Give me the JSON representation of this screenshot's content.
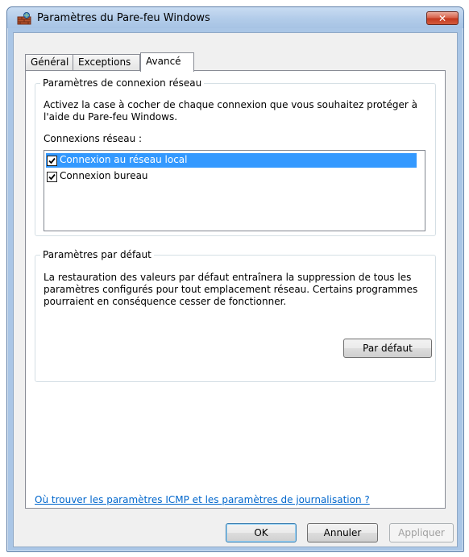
{
  "window": {
    "title": "Paramètres du Pare-feu Windows",
    "close_label": "✕",
    "accent_color": "#3399ff"
  },
  "tabs": [
    {
      "label": "Général",
      "active": false
    },
    {
      "label": "Exceptions",
      "active": false
    },
    {
      "label": "Avancé",
      "active": true
    }
  ],
  "network_group": {
    "title": "Paramètres de connexion réseau",
    "description": "Activez la case à cocher de chaque connexion que vous souhaitez protéger à l'aide du Pare-feu Windows.",
    "list_label": "Connexions réseau :",
    "connections": [
      {
        "label": "Connexion au réseau local",
        "checked": true,
        "selected": true
      },
      {
        "label": "Connexion bureau",
        "checked": true,
        "selected": false
      }
    ]
  },
  "defaults_group": {
    "title": "Paramètres par défaut",
    "description": "La restauration des valeurs par défaut entraînera la suppression de tous les paramètres configurés pour tout emplacement réseau. Certains programmes pourraient en conséquence cesser de fonctionner.",
    "button_label": "Par défaut"
  },
  "help_link": "Où trouver les paramètres ICMP et les paramètres de journalisation ?",
  "footer": {
    "ok_label": "OK",
    "cancel_label": "Annuler",
    "apply_label": "Appliquer",
    "apply_enabled": false
  }
}
